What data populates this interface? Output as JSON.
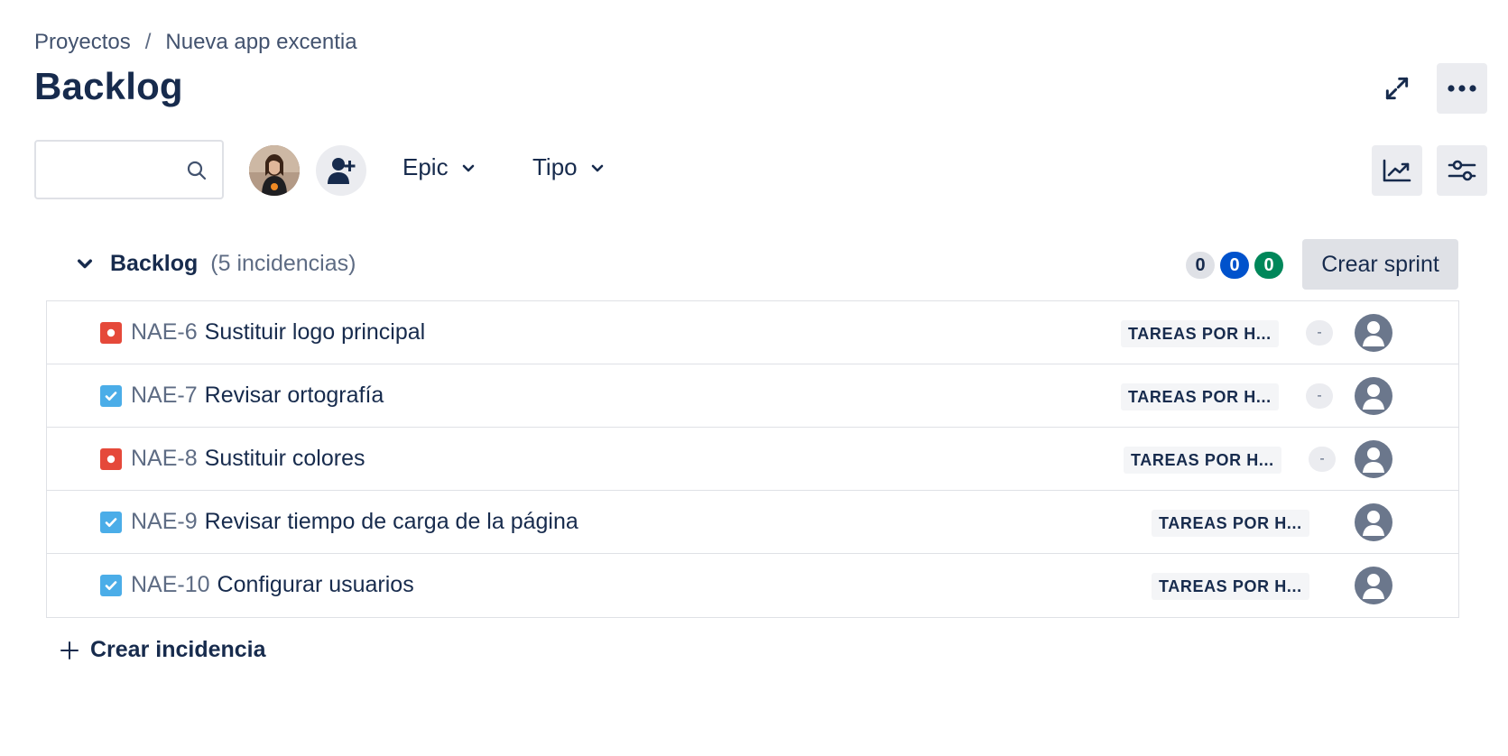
{
  "breadcrumb": {
    "projects": "Proyectos",
    "separator": "/",
    "project": "Nueva app excentia"
  },
  "page": {
    "title": "Backlog"
  },
  "toolbar": {
    "search_placeholder": "",
    "filters": [
      {
        "label": "Epic"
      },
      {
        "label": "Tipo"
      }
    ]
  },
  "backlog": {
    "name": "Backlog",
    "count_label": "(5 incidencias)",
    "counts": {
      "todo": "0",
      "in_progress": "0",
      "done": "0"
    },
    "create_sprint_label": "Crear sprint",
    "issues": [
      {
        "key": "NAE-6",
        "summary": "Sustituir logo principal",
        "type": "bug",
        "epic": "TAREAS POR H...",
        "estimate": "-"
      },
      {
        "key": "NAE-7",
        "summary": "Revisar ortografía",
        "type": "task",
        "epic": "TAREAS POR H...",
        "estimate": "-"
      },
      {
        "key": "NAE-8",
        "summary": "Sustituir colores",
        "type": "bug",
        "epic": "TAREAS POR H...",
        "estimate": "-"
      },
      {
        "key": "NAE-9",
        "summary": "Revisar tiempo de carga de la página",
        "type": "task",
        "epic": "TAREAS POR H...",
        "estimate": ""
      },
      {
        "key": "NAE-10",
        "summary": "Configurar usuarios",
        "type": "task",
        "epic": "TAREAS POR H...",
        "estimate": ""
      }
    ],
    "create_issue_label": "Crear incidencia"
  },
  "colors": {
    "bug": "#e5493a",
    "task": "#4bade8",
    "count_blue": "#0052cc",
    "count_green": "#00875a"
  },
  "icons": {
    "search": "search-icon",
    "expand": "expand-icon",
    "more": "more-icon",
    "add_user": "add-user-icon",
    "insights": "insights-icon",
    "view_settings": "view-settings-icon"
  }
}
